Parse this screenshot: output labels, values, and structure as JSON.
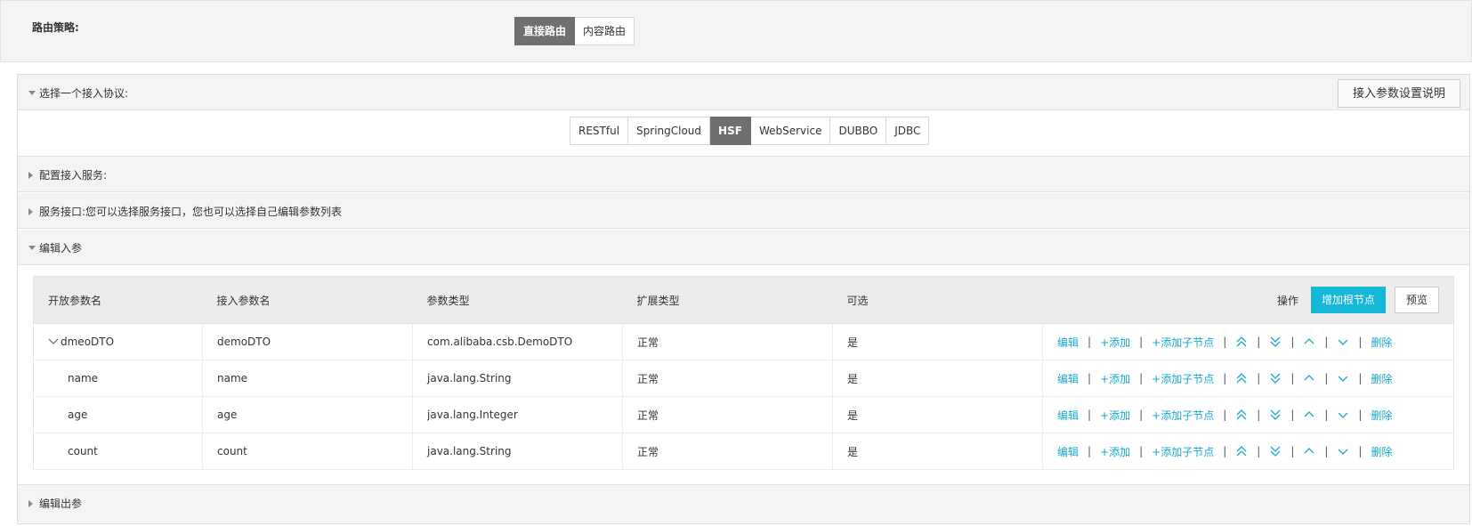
{
  "route": {
    "label": "路由策略:",
    "options": [
      {
        "label": "直接路由",
        "active": true
      },
      {
        "label": "内容路由",
        "active": false
      }
    ]
  },
  "sections": {
    "protocol_title": "选择一个接入协议:",
    "help_button": "接入参数设置说明",
    "protocols": [
      {
        "label": "RESTful",
        "active": false
      },
      {
        "label": "SpringCloud",
        "active": false
      },
      {
        "label": "HSF",
        "active": true
      },
      {
        "label": "WebService",
        "active": false
      },
      {
        "label": "DUBBO",
        "active": false
      },
      {
        "label": "JDBC",
        "active": false
      }
    ],
    "service_title": "配置接入服务:",
    "iface_title": "服务接口:您可以选择服务接口，您也可以选择自己编辑参数列表",
    "input_title": "编辑入参",
    "output_title": "编辑出参"
  },
  "table": {
    "headers": {
      "open_name": "开放参数名",
      "access_name": "接入参数名",
      "type": "参数类型",
      "ext_type": "扩展类型",
      "optional": "可选",
      "ops": "操作"
    },
    "add_root_button": "增加根节点",
    "preview_button": "预览",
    "rows": [
      {
        "open_name": "dmeoDTO",
        "access_name": "demoDTO",
        "type": "com.alibaba.csb.DemoDTO",
        "ext_type": "正常",
        "optional": "是"
      },
      {
        "open_name": "name",
        "access_name": "name",
        "type": "java.lang.String",
        "ext_type": "正常",
        "optional": "是"
      },
      {
        "open_name": "age",
        "access_name": "age",
        "type": "java.lang.Integer",
        "ext_type": "正常",
        "optional": "是"
      },
      {
        "open_name": "count",
        "access_name": "count",
        "type": "java.lang.String",
        "ext_type": "正常",
        "optional": "是"
      }
    ],
    "ops": {
      "edit": "编辑",
      "add": "+添加",
      "add_child": "+添加子节点",
      "delete": "删除",
      "sep": "|"
    }
  },
  "colors": {
    "accent": "#16b8d9",
    "link": "#16a9d1",
    "active_segment": "#6f6f6f"
  },
  "icons": [
    "double-up-icon",
    "double-down-icon",
    "up-icon",
    "down-icon",
    "chevron-down-icon",
    "triangle-down-icon",
    "triangle-right-icon"
  ]
}
